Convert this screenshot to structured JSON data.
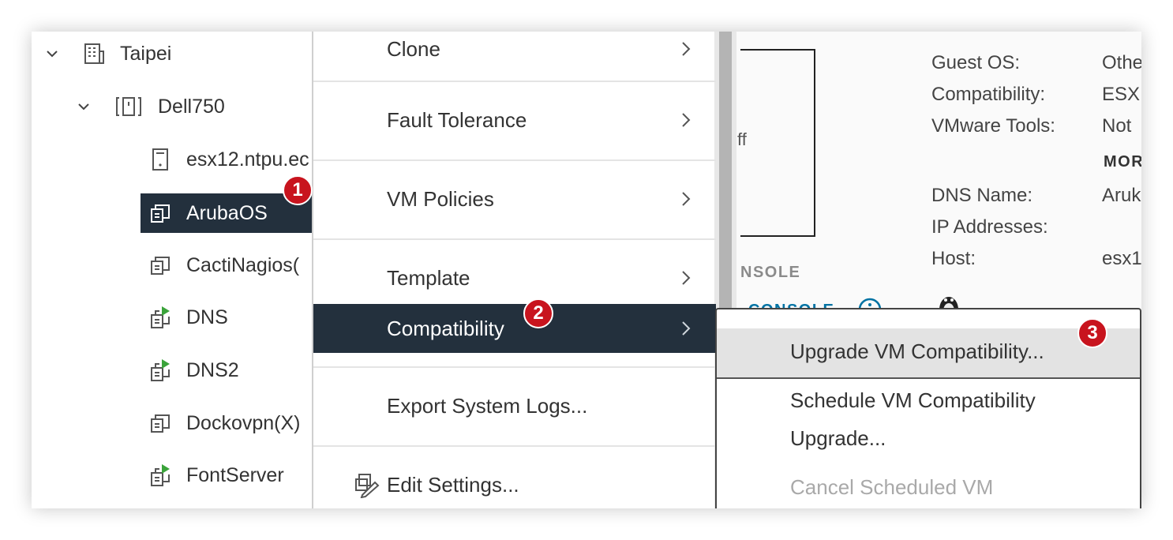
{
  "tree": {
    "items": [
      {
        "label": "Taipei",
        "icon": "datacenter-icon"
      },
      {
        "label": "Dell750",
        "icon": "cluster-icon"
      },
      {
        "label": "esx12.ntpu.ec",
        "icon": "host-icon"
      },
      {
        "label": "ArubaOS",
        "icon": "vm-icon",
        "selected": true
      },
      {
        "label": "CactiNagios(",
        "icon": "vm-icon"
      },
      {
        "label": "DNS",
        "icon": "vm-powered-on-icon"
      },
      {
        "label": "DNS2",
        "icon": "vm-powered-on-icon"
      },
      {
        "label": "Dockovpn(X)",
        "icon": "vm-icon"
      },
      {
        "label": "FontServer",
        "icon": "vm-powered-on-icon"
      }
    ]
  },
  "menu": {
    "items": [
      {
        "label": "Clone",
        "submenu": true
      },
      {
        "label": "Fault Tolerance",
        "submenu": true
      },
      {
        "label": "VM Policies",
        "submenu": true
      },
      {
        "label": "Template",
        "submenu": true
      },
      {
        "label": "Compatibility",
        "submenu": true,
        "active": true
      },
      {
        "label": "Export System Logs...",
        "submenu": false
      },
      {
        "label": "Edit Settings...",
        "submenu": false,
        "icon": "edit-settings-icon"
      }
    ]
  },
  "submenu": {
    "items": [
      {
        "label": "Upgrade VM Compatibility...",
        "hover": true
      },
      {
        "label": "Schedule VM Compatibility",
        "label2": "Upgrade..."
      },
      {
        "label": "Cancel Scheduled VM",
        "disabled": true
      }
    ]
  },
  "summary": {
    "power_text": "ff",
    "console_text": "NSOLE",
    "console_link": "CONSOLE",
    "more_link": "MOR",
    "properties": [
      {
        "label": "Guest OS:",
        "value": "Othe"
      },
      {
        "label": "Compatibility:",
        "value": "ESX"
      },
      {
        "label": "VMware Tools:",
        "value": "Not"
      },
      {
        "label": "DNS Name:",
        "value": "Aruk"
      },
      {
        "label": "IP Addresses:",
        "value": ""
      },
      {
        "label": "Host:",
        "value": "esx1"
      }
    ]
  },
  "badges": [
    "1",
    "2",
    "3"
  ],
  "colors": {
    "selected_bg": "#23303d",
    "badge": "#c8141e",
    "power_on": "#3aa33a"
  }
}
